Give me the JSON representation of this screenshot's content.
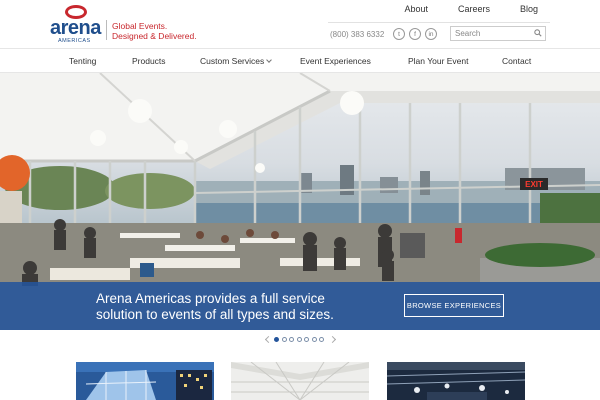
{
  "brand": {
    "logo_word": "arena",
    "logo_sub": "AMERICAS",
    "tagline_line1": "Global Events.",
    "tagline_line2": "Designed & Delivered.",
    "primary_color": "#1f4e8c",
    "accent_color": "#c8282e"
  },
  "top_links": [
    "About",
    "Careers",
    "Blog"
  ],
  "utility": {
    "phone": "(800) 383 6332",
    "social": [
      {
        "icon": "twitter-icon",
        "glyph": "t"
      },
      {
        "icon": "facebook-icon",
        "glyph": "f"
      },
      {
        "icon": "linkedin-icon",
        "glyph": "in"
      }
    ],
    "search_placeholder": "Search"
  },
  "nav": [
    {
      "label": "Tenting",
      "dropdown": false
    },
    {
      "label": "Products",
      "dropdown": false
    },
    {
      "label": "Custom Services",
      "dropdown": true
    },
    {
      "label": "Event Experiences",
      "dropdown": false
    },
    {
      "label": "Plan Your Event",
      "dropdown": false
    },
    {
      "label": "Contact",
      "dropdown": false
    }
  ],
  "hero": {
    "headline_line1": "Arena Americas provides a full service",
    "headline_line2": "solution to events of all types and sizes.",
    "button_label": "BROWSE EXPERIENCES",
    "exit_sign": "EXIT",
    "band_color": "#24549b"
  },
  "slider": {
    "total": 8,
    "active": 1
  },
  "thumbnails": [
    {
      "name": "glass-structure-night"
    },
    {
      "name": "tent-interior"
    },
    {
      "name": "event-hall-interior"
    }
  ]
}
